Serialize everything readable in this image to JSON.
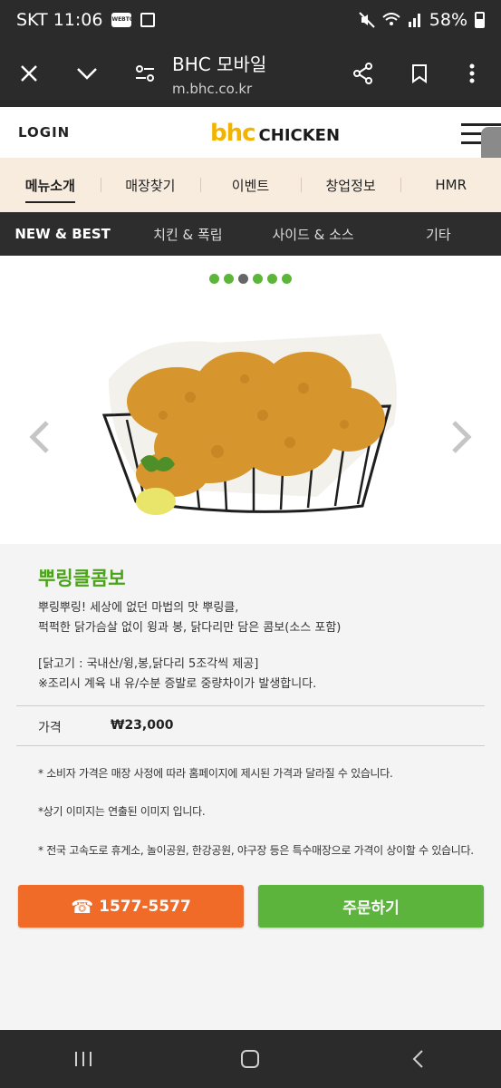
{
  "status_bar": {
    "carrier_time": "SKT 11:06",
    "battery": "58%",
    "webtoon": "WEBTOON"
  },
  "browser": {
    "title": "BHC 모바일",
    "url": "m.bhc.co.kr"
  },
  "site": {
    "login": "LOGIN",
    "logo_bhc": "bhc",
    "logo_chicken": "CHICKEN",
    "main_menu": [
      "메뉴소개",
      "매장찾기",
      "이벤트",
      "창업정보",
      "HMR"
    ],
    "sub_menu": [
      "NEW & BEST",
      "치킨 & 폭립",
      "사이드 & 소스",
      "기타"
    ]
  },
  "carousel": {
    "dots": 6,
    "current": 3
  },
  "product": {
    "name": "뿌링클콤보",
    "desc1": "뿌링뿌링! 세상에 없던 마법의 맛 뿌링클,",
    "desc2": "퍽퍽한 닭가슴살 없이 윙과 봉, 닭다리만 담은 콤보(소스 포함)",
    "origin1": "[닭고기 : 국내산/윙,봉,닭다리 5조각씩 제공]",
    "origin2": "※조리시 계육 내 유/수분 증발로 중량차이가 발생합니다.",
    "price_label": "가격",
    "price": "₩23,000"
  },
  "notes": [
    "* 소비자 가격은 매장 사정에 따라 홈페이지에 제시된 가격과 달라질 수 있습니다.",
    "*상기 이미지는 연출된 이미지 입니다.",
    "* 전국 고속도로 휴게소, 놀이공원, 한강공원, 야구장 등은 특수매장으로 가격이 상이할 수 있습니다."
  ],
  "buttons": {
    "call": "1577-5577",
    "order": "주문하기"
  },
  "colors": {
    "accent_green": "#5cb43c",
    "accent_orange": "#f06b28",
    "logo_yellow": "#f2b400"
  }
}
